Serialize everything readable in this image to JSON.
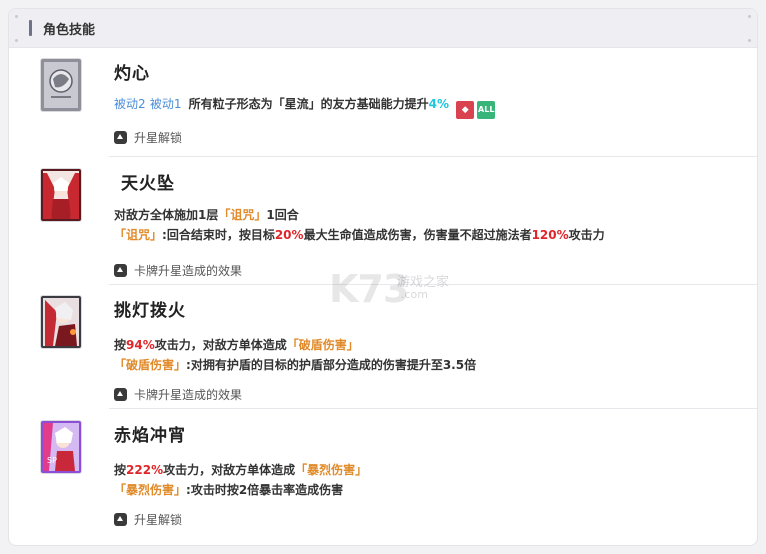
{
  "header": {
    "title": "角色技能"
  },
  "skills": [
    {
      "name": "灼心",
      "tag1": "被动2",
      "tag2": "被动1",
      "desc_a": "所有粒子形态为「星流」的友方基础能力提升",
      "desc_b": "4%",
      "badge_all": "ALL",
      "footer": "升星解锁"
    },
    {
      "name": "天火坠",
      "l1_a": "对敌方全体施加1层",
      "l1_b": "「诅咒」",
      "l1_c": "1回合",
      "l2_a": "「诅咒」",
      "l2_b": ":回合结束时，按目标",
      "l2_c": "20%",
      "l2_d": "最大生命值造成伤害，伤害量不超过施法者",
      "l2_e": "120%",
      "l2_f": "攻击力",
      "footer": "卡牌升星造成的效果"
    },
    {
      "name": "挑灯拨火",
      "l1_a": "按",
      "l1_b": "94%",
      "l1_c": "攻击力，对敌方单体造成",
      "l1_d": "「破盾伤害」",
      "l2_a": "「破盾伤害」",
      "l2_b": ":对拥有护盾的目标的护盾部分造成的伤害提升至3.5倍",
      "footer": "卡牌升星造成的效果"
    },
    {
      "name": "赤焰冲宵",
      "l1_a": "按",
      "l1_b": "222%",
      "l1_c": "攻击力，对敌方单体造成",
      "l1_d": "「暴烈伤害」",
      "l2_a": "「暴烈伤害」",
      "l2_b": ":攻击时按2倍暴击率造成伤害",
      "footer": "升星解锁"
    }
  ],
  "watermark": {
    "logo": "K73",
    "sub": "游戏之家",
    "url": ".com"
  },
  "colors": {
    "accent_red": "#e0262a",
    "accent_orange": "#e08a2a",
    "accent_cyan": "#1fc7dc",
    "link_blue": "#4c8ed9"
  }
}
